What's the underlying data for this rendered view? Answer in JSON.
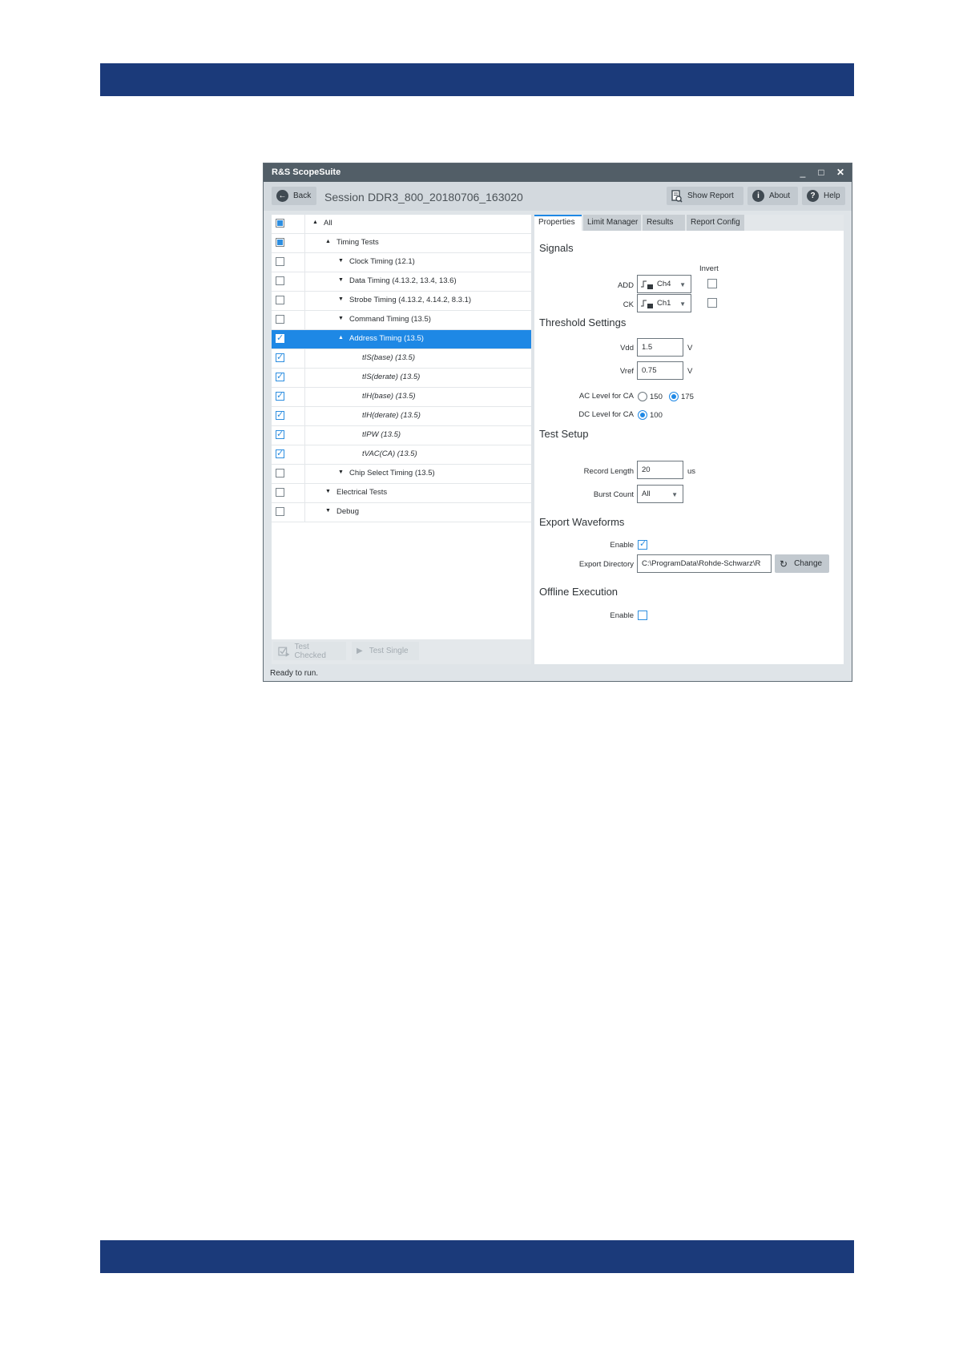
{
  "window": {
    "title": "R&S ScopeSuite",
    "controls": [
      "_",
      "□",
      "✕"
    ]
  },
  "toolbar": {
    "back_label": "Back",
    "session_label": "Session",
    "session_name": "DDR3_800_20180706_163020",
    "show_report_label": "Show Report",
    "about_label": "About",
    "help_label": "Help"
  },
  "tree": {
    "items": [
      {
        "label": "All",
        "state": "partial",
        "expanded": true
      },
      {
        "label": "Timing Tests",
        "state": "partial",
        "expanded": true
      },
      {
        "label": "Clock Timing (12.1)",
        "state": "unchecked",
        "expanded": false
      },
      {
        "label": "Data Timing (4.13.2, 13.4, 13.6)",
        "state": "unchecked",
        "expanded": false
      },
      {
        "label": "Strobe Timing (4.13.2, 4.14.2, 8.3.1)",
        "state": "unchecked",
        "expanded": false
      },
      {
        "label": "Command Timing (13.5)",
        "state": "unchecked",
        "expanded": false
      },
      {
        "label": "Address Timing (13.5)",
        "state": "checked",
        "expanded": true,
        "selected": true
      },
      {
        "label": "tIS(base) (13.5)",
        "state": "checked"
      },
      {
        "label": "tIS(derate) (13.5)",
        "state": "checked"
      },
      {
        "label": "tIH(base) (13.5)",
        "state": "checked"
      },
      {
        "label": "tIH(derate) (13.5)",
        "state": "checked"
      },
      {
        "label": "tIPW (13.5)",
        "state": "checked"
      },
      {
        "label": "tVAC(CA) (13.5)",
        "state": "checked"
      },
      {
        "label": "Chip Select Timing (13.5)",
        "state": "unchecked",
        "expanded": false
      },
      {
        "label": "Electrical Tests",
        "state": "unchecked",
        "expanded": false
      },
      {
        "label": "Debug",
        "state": "unchecked",
        "expanded": false
      }
    ],
    "test_checked_label": "Test Checked",
    "test_single_label": "Test Single"
  },
  "tabs": [
    "Properties",
    "Limit Manager",
    "Results",
    "Report Config"
  ],
  "properties": {
    "signals_title": "Signals",
    "invert_label": "Invert",
    "add_label": "ADD",
    "add_channel": "Ch4",
    "ck_label": "CK",
    "ck_channel": "Ch1",
    "threshold_title": "Threshold Settings",
    "vdd_label": "Vdd",
    "vdd_value": "1.5",
    "vdd_unit": "V",
    "vref_label": "Vref",
    "vref_value": "0.75",
    "vref_unit": "V",
    "ac_level_label": "AC Level for CA",
    "ac_option_150": "150",
    "ac_option_175": "175",
    "dc_level_label": "DC Level for CA",
    "dc_option_100": "100",
    "test_setup_title": "Test Setup",
    "record_length_label": "Record Length",
    "record_length_value": "20",
    "record_length_unit": "us",
    "burst_count_label": "Burst Count",
    "burst_count_value": "All",
    "export_title": "Export Waveforms",
    "export_enable_label": "Enable",
    "export_dir_label": "Export Directory",
    "export_dir_value": "C:\\ProgramData\\Rohde-Schwarz\\R",
    "change_label": "Change",
    "offline_title": "Offline Execution",
    "offline_enable_label": "Enable"
  },
  "status": "Ready to run.",
  "colors": {
    "doc_bar": "#1b3a7a",
    "selection": "#1e88e5",
    "titlebar": "#525e67"
  }
}
